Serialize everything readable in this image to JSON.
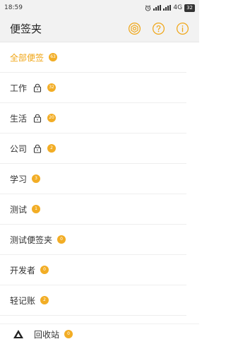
{
  "status_bar": {
    "time": "18:59",
    "network": "4G",
    "battery": "32"
  },
  "header": {
    "title": "便签夹",
    "settings_icon": "gear-icon",
    "help_icon": "question-circle-icon",
    "info_icon": "info-circle-icon",
    "accent": "#f0a616"
  },
  "folders": [
    {
      "label": "全部便签",
      "count": "63",
      "locked": false,
      "active": true
    },
    {
      "label": "工作",
      "count": "32",
      "locked": true,
      "active": false
    },
    {
      "label": "生活",
      "count": "20",
      "locked": true,
      "active": false
    },
    {
      "label": "公司",
      "count": "2",
      "locked": true,
      "active": false
    },
    {
      "label": "学习",
      "count": "3",
      "locked": false,
      "active": false
    },
    {
      "label": "测试",
      "count": "1",
      "locked": false,
      "active": false
    },
    {
      "label": "测试便签夹",
      "count": "0",
      "locked": false,
      "active": false
    },
    {
      "label": "开发者",
      "count": "0",
      "locked": false,
      "active": false
    },
    {
      "label": "轻记账",
      "count": "2",
      "locked": false,
      "active": false
    }
  ],
  "trash": {
    "label": "回收站",
    "count": "0",
    "icon": "trash-triangle-icon"
  },
  "colors": {
    "badge": "#f2ad25",
    "accent": "#f0a616"
  }
}
